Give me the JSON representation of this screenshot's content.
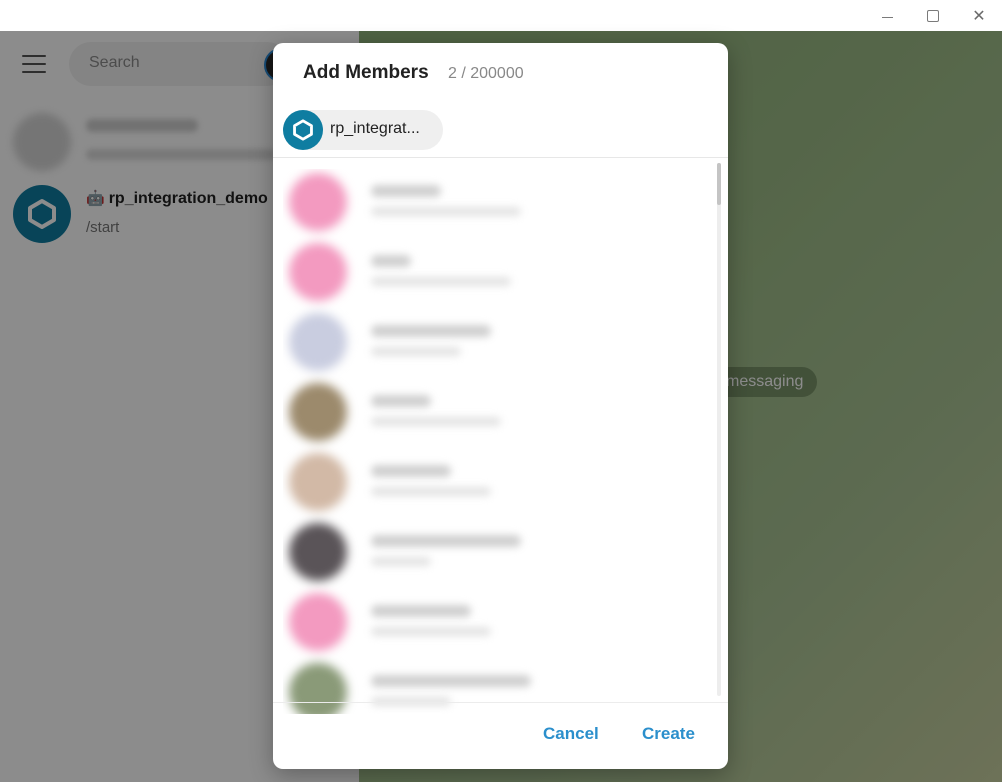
{
  "sidebar": {
    "search": {
      "placeholder": "Search"
    },
    "chats": [
      {
        "name": "",
        "preview": ""
      },
      {
        "name": "rp_integration_demo",
        "preview": "/start"
      }
    ]
  },
  "chat_area": {
    "service_message": "messaging"
  },
  "modal": {
    "title": "Add Members",
    "count": "2 / 200000",
    "selected_chip": {
      "label": "rp_integrat..."
    },
    "contacts": [
      {
        "avatar_color": "#f39ac0"
      },
      {
        "avatar_color": "#f39ac0"
      },
      {
        "avatar_color": "#c9cde0"
      },
      {
        "avatar_color": "#9c8a6c"
      },
      {
        "avatar_color": "#d2b9a6"
      },
      {
        "avatar_color": "#5a5458"
      },
      {
        "avatar_color": "#f39ac0"
      },
      {
        "avatar_color": "#8a9a78"
      }
    ],
    "buttons": {
      "cancel": "Cancel",
      "create": "Create"
    }
  },
  "colors": {
    "accent": "#2b8fcc",
    "bot_avatar": "#0f7da1"
  }
}
